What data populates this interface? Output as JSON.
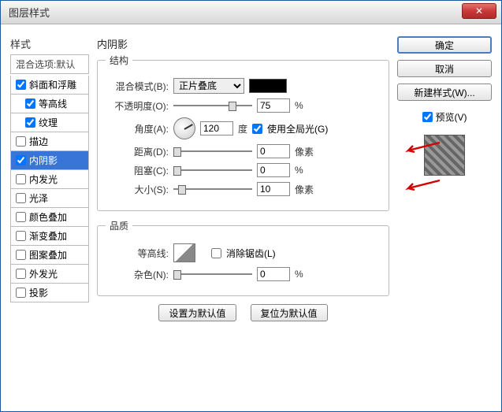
{
  "window": {
    "title": "图层样式"
  },
  "buttons": {
    "close": "✕",
    "ok": "确定",
    "cancel": "取消",
    "newStyle": "新建样式(W)...",
    "preview": "预览(V)",
    "setDefault": "设置为默认值",
    "resetDefault": "复位为默认值"
  },
  "left": {
    "header": "样式",
    "blend": "混合选项:默认",
    "items": [
      {
        "label": "斜面和浮雕",
        "checked": true
      },
      {
        "label": "等高线",
        "checked": true,
        "indent": true
      },
      {
        "label": "纹理",
        "checked": true,
        "indent": true
      },
      {
        "label": "描边",
        "checked": false
      },
      {
        "label": "内阴影",
        "checked": true,
        "active": true
      },
      {
        "label": "内发光",
        "checked": false
      },
      {
        "label": "光泽",
        "checked": false
      },
      {
        "label": "颜色叠加",
        "checked": false
      },
      {
        "label": "渐变叠加",
        "checked": false
      },
      {
        "label": "图案叠加",
        "checked": false
      },
      {
        "label": "外发光",
        "checked": false
      },
      {
        "label": "投影",
        "checked": false
      }
    ]
  },
  "center": {
    "title": "内阴影",
    "group1": "结构",
    "blendModeLabel": "混合模式(B):",
    "blendModeValue": "正片叠底",
    "opacityLabel": "不透明度(O):",
    "opacityValue": "75",
    "pct": "%",
    "angleLabel": "角度(A):",
    "angleValue": "120",
    "degree": "度",
    "useGlobal": "使用全局光(G)",
    "distanceLabel": "距离(D):",
    "distanceValue": "0",
    "px": "像素",
    "chokeLabel": "阻塞(C):",
    "chokeValue": "0",
    "sizeLabel": "大小(S):",
    "sizeValue": "10",
    "group2": "品质",
    "contourLabel": "等高线:",
    "antiAlias": "消除锯齿(L)",
    "noiseLabel": "杂色(N):",
    "noiseValue": "0"
  }
}
